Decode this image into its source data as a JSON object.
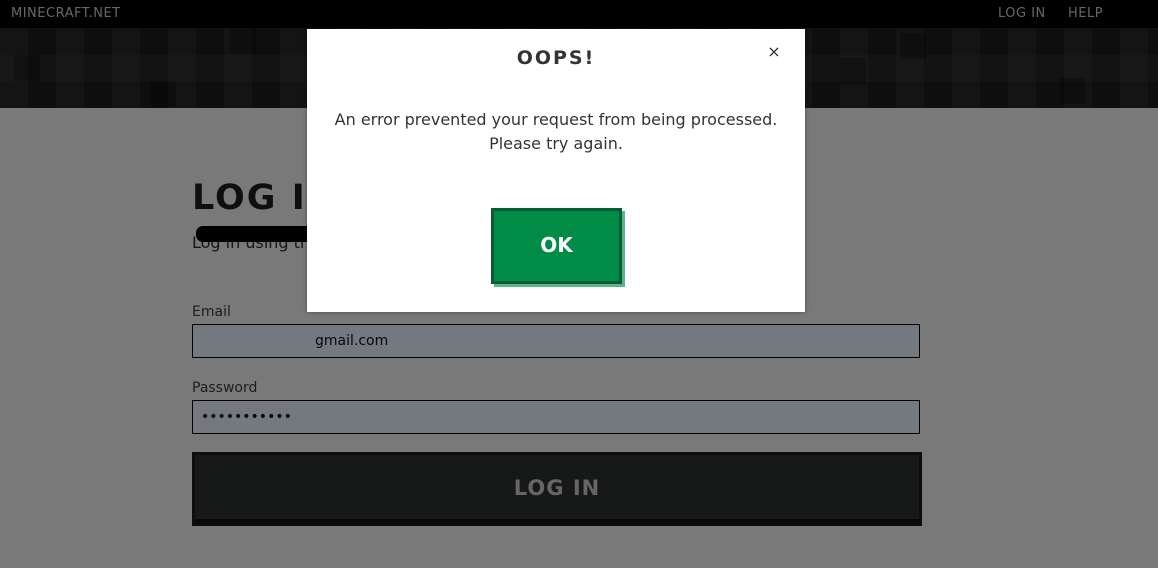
{
  "nav": {
    "brand": "MINECRAFT.NET",
    "login": "LOG IN",
    "help": "HELP"
  },
  "page": {
    "title": "LOG IN",
    "intro": "Log in using the … you no longer have the passw…"
  },
  "form": {
    "email_label": "Email",
    "email_value": "gmail.com",
    "password_label": "Password",
    "password_value": "•••••••••••",
    "submit_label": "LOG IN"
  },
  "modal": {
    "title": "OOPS!",
    "close": "×",
    "message_line1": "An error prevented your request from being processed.",
    "message_line2": "Please try again.",
    "ok_label": "OK"
  },
  "colors": {
    "ok_green": "#008c47",
    "nav_bg": "#000000",
    "button_dark": "#2d3331"
  }
}
